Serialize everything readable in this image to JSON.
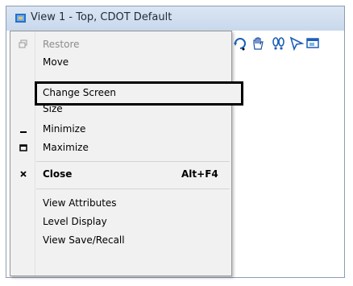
{
  "window": {
    "title": "View 1 - Top, CDOT Default"
  },
  "toolbar": {
    "icons": [
      "rotate-view-icon",
      "pan-hand-icon",
      "footsteps-icon",
      "select-arrow-icon",
      "view-window-icon"
    ]
  },
  "menu": {
    "items": [
      {
        "label": "Restore",
        "icon": "restore-icon",
        "disabled": true
      },
      {
        "label": "Move"
      },
      {
        "label": "Change Screen",
        "highlighted": true
      },
      {
        "label": "Size"
      },
      {
        "label": "Minimize",
        "icon": "minimize-icon"
      },
      {
        "label": "Maximize",
        "icon": "maximize-icon"
      },
      {
        "label": "Close",
        "icon": "close-icon",
        "shortcut": "Alt+F4",
        "bold": true
      },
      {
        "label": "View Attributes"
      },
      {
        "label": "Level Display"
      },
      {
        "label": "View Save/Recall"
      }
    ]
  },
  "colors": {
    "titlebar": "#c8d8ec",
    "menu_bg": "#f1f1f1",
    "highlight_border": "#000000"
  }
}
